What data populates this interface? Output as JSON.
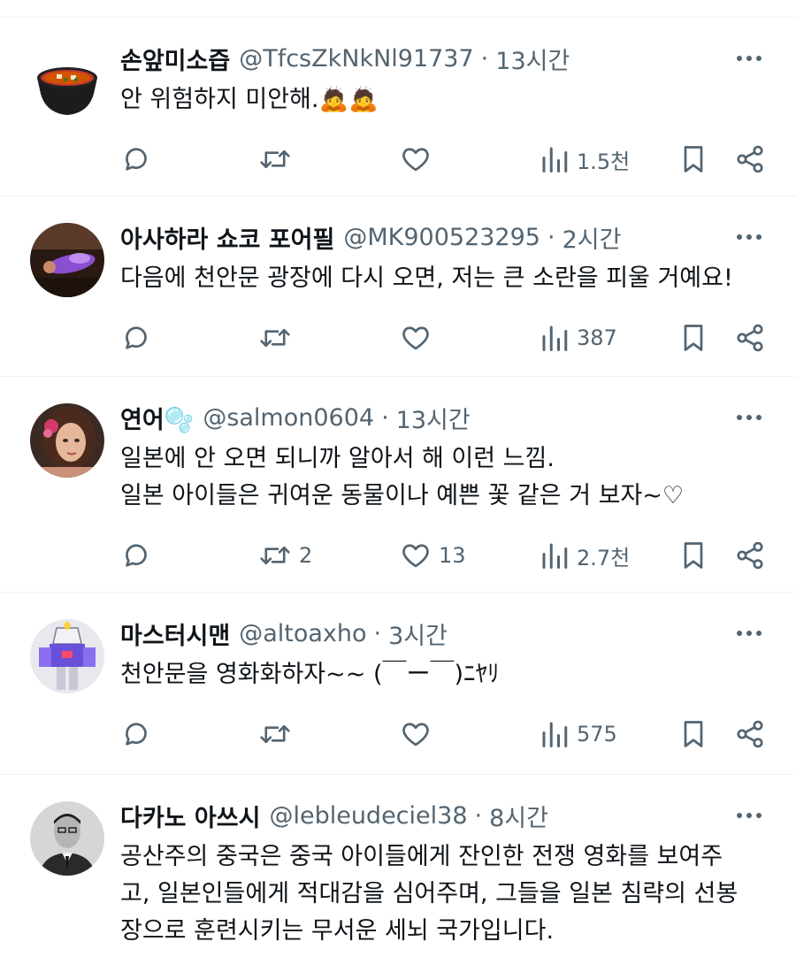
{
  "colors": {
    "text": "#0f1419",
    "secondary": "#536471",
    "divider": "#eff3f4",
    "background": "#ffffff"
  },
  "tweets": [
    {
      "name": "손앞미소즙",
      "handle": "@TfcsZkNkNl91737",
      "time": "13시간",
      "lines": [
        "안 위험하지 미안해.🙇🙇"
      ],
      "replies": "",
      "retweets": "",
      "likes": "",
      "views": "1.5천",
      "avatar_icon": "miso-soup-bowl"
    },
    {
      "name": "아사하라 쇼코 포어필",
      "handle": "@MK900523295",
      "time": "2시간",
      "lines": [
        "다음에 천안문 광장에 다시 오면, 저는 큰 소란을 피울 거예요!"
      ],
      "replies": "",
      "retweets": "",
      "likes": "",
      "views": "387",
      "avatar_icon": "purple-figure-photo"
    },
    {
      "name": "연어🫧",
      "handle": "@salmon0604",
      "time": "13시간",
      "lines": [
        "일본에 안 오면 되니까 알아서 해 이런 느낌.",
        "일본 아이들은 귀여운 동물이나 예쁜 꽃 같은 거 보자~♡"
      ],
      "replies": "",
      "retweets": "2",
      "likes": "13",
      "views": "2.7천",
      "avatar_icon": "woman-portrait"
    },
    {
      "name": "마스터시맨",
      "handle": "@altoaxho",
      "time": "3시간",
      "lines": [
        "천안문을 영화화하자~~ (￣ー￣)ﾆﾔﾘ"
      ],
      "replies": "",
      "retweets": "",
      "likes": "",
      "views": "575",
      "avatar_icon": "robot-figure"
    },
    {
      "name": "다카노 아쓰시",
      "handle": "@lebleudeciel38",
      "time": "8시간",
      "lines": [
        "공산주의 중국은 중국 아이들에게 잔인한 전쟁 영화를 보여주",
        "고, 일본인들에게 적대감을 심어주며, 그들을 일본 침략의 선봉",
        "장으로 훈련시키는 무서운 세뇌 국가입니다."
      ],
      "replies": "",
      "retweets": "",
      "likes": "",
      "views": "",
      "avatar_icon": "man-bw-portrait"
    }
  ]
}
